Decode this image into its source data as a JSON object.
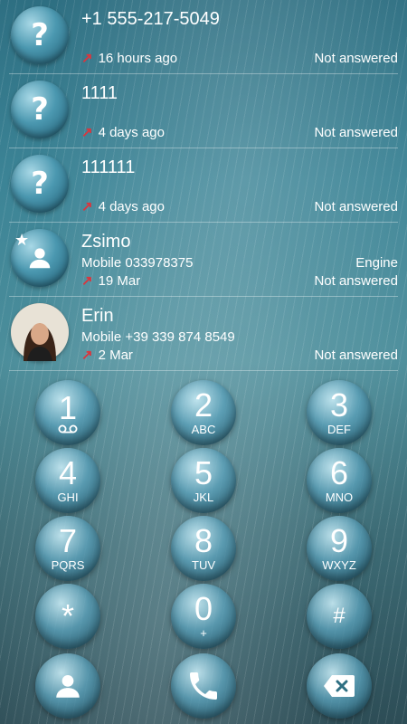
{
  "calls": [
    {
      "name": "+1 555-217-5049",
      "date": "16 hours ago",
      "status": "Not answered",
      "avatar": "unknown",
      "sub": "",
      "label": ""
    },
    {
      "name": "1111",
      "date": "4 days ago",
      "status": "Not answered",
      "avatar": "unknown",
      "sub": "",
      "label": ""
    },
    {
      "name": "111111",
      "date": "4 days ago",
      "status": "Not answered",
      "avatar": "unknown",
      "sub": "",
      "label": ""
    },
    {
      "name": "Zsimo",
      "sub": "Mobile 033978375",
      "label": "Engine",
      "date": "19 Mar",
      "status": "Not answered",
      "avatar": "contact"
    },
    {
      "name": "Erin",
      "sub": "Mobile +39 339 874 8549",
      "label": "",
      "date": "2 Mar",
      "status": "Not answered",
      "avatar": "photo"
    }
  ],
  "unknown_symbol": "?",
  "missed_arrow": "↗",
  "favorite_star": "★",
  "keys": [
    {
      "digit": "1",
      "letters": ""
    },
    {
      "digit": "2",
      "letters": "ABC"
    },
    {
      "digit": "3",
      "letters": "DEF"
    },
    {
      "digit": "4",
      "letters": "GHI"
    },
    {
      "digit": "5",
      "letters": "JKL"
    },
    {
      "digit": "6",
      "letters": "MNO"
    },
    {
      "digit": "7",
      "letters": "PQRS"
    },
    {
      "digit": "8",
      "letters": "TUV"
    },
    {
      "digit": "9",
      "letters": "WXYZ"
    },
    {
      "digit": "*",
      "letters": ""
    },
    {
      "digit": "0",
      "letters": "+"
    },
    {
      "digit": "#",
      "letters": ""
    }
  ],
  "icons": {
    "voicemail": "voicemail-icon",
    "contacts": "person-icon",
    "call": "phone-icon",
    "backspace": "backspace-icon"
  },
  "colors": {
    "missed_arrow": "#d9363e"
  }
}
